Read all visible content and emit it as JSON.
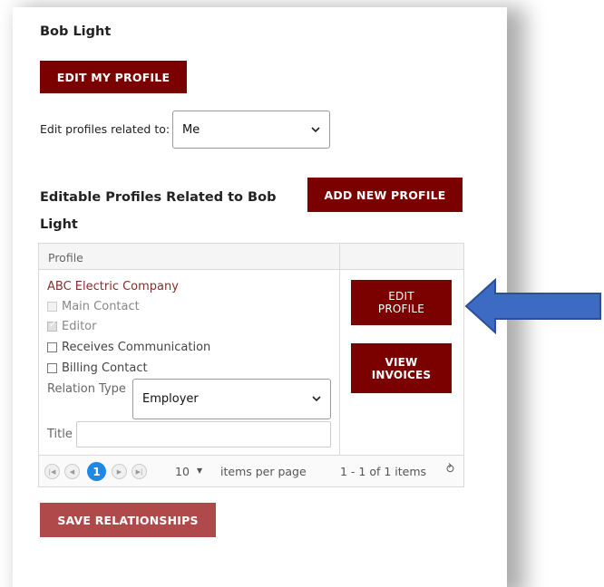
{
  "user": {
    "name": "Bob Light"
  },
  "buttons": {
    "edit_my_profile": "EDIT MY PROFILE",
    "add_new_profile": "ADD NEW PROFILE",
    "edit_profile": "EDIT\nPROFILE",
    "view_invoices": "VIEW\nINVOICES",
    "save_relationships": "SAVE RELATIONSHIPS"
  },
  "filter": {
    "label": "Edit profiles related to:",
    "selected": "Me"
  },
  "section": {
    "title": "Editable Profiles Related to Bob Light"
  },
  "grid": {
    "column_header": "Profile",
    "row": {
      "company": "ABC Electric Company",
      "checkboxes": [
        {
          "label": "Main Contact",
          "checked": false,
          "disabled": true
        },
        {
          "label": "Editor",
          "checked": true,
          "disabled": true
        },
        {
          "label": "Receives Communication",
          "checked": false,
          "disabled": false
        },
        {
          "label": "Billing Contact",
          "checked": false,
          "disabled": false
        }
      ],
      "relation_type_label": "Relation Type",
      "relation_type_value": "Employer",
      "title_label": "Title",
      "title_value": ""
    },
    "pager": {
      "current_page": "1",
      "page_size": "10",
      "per_page_label": "items per page",
      "info": "1 - 1 of 1 items"
    }
  },
  "colors": {
    "primary_button": "#7b0000",
    "save_button": "#b04a4a",
    "link": "#8a2c2c",
    "page_active": "#1e88e5",
    "arrow": "#3d6bc4"
  }
}
